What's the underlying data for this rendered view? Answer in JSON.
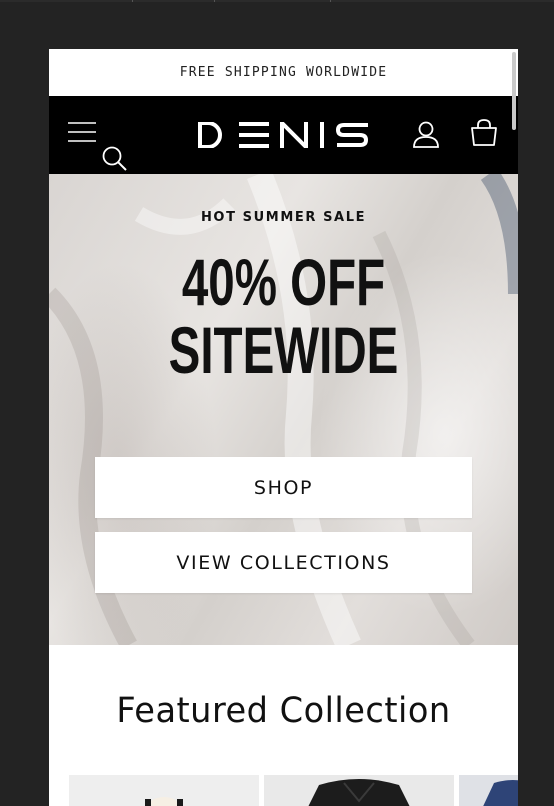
{
  "announcement": {
    "text": "FREE SHIPPING WORLDWIDE"
  },
  "header": {
    "logo_text": "DENIS",
    "icons": [
      "menu-icon",
      "search-icon",
      "account-icon",
      "cart-icon"
    ]
  },
  "hero": {
    "eyebrow": "HOT SUMMER SALE",
    "headline_line1": "40% OFF",
    "headline_line2": "SITEWIDE",
    "primary_button": "SHOP",
    "secondary_button": "VIEW COLLECTIONS"
  },
  "featured": {
    "title": "Featured Collection"
  },
  "colors": {
    "page_background": "#232323",
    "header_background": "#000000",
    "accent_text": "#111111",
    "button_background": "#ffffff"
  }
}
